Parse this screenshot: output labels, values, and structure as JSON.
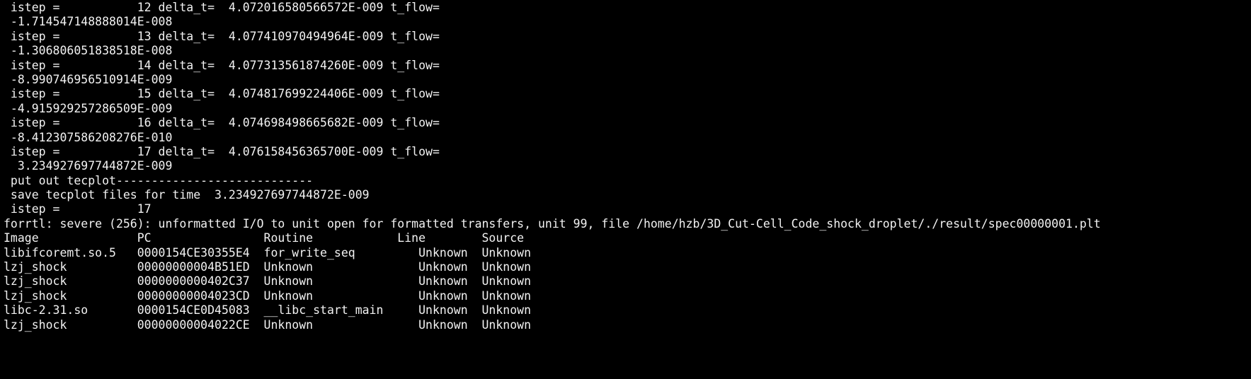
{
  "terminal": {
    "lines": [
      " istep =           12 delta_t=  4.072016580566572E-009 t_flow=",
      " -1.714547148888014E-008",
      " istep =           13 delta_t=  4.077410970494964E-009 t_flow=",
      " -1.306806051838518E-008",
      " istep =           14 delta_t=  4.077313561874260E-009 t_flow=",
      " -8.990746956510914E-009",
      " istep =           15 delta_t=  4.074817699224406E-009 t_flow=",
      " -4.915929257286509E-009",
      " istep =           16 delta_t=  4.074698498665682E-009 t_flow=",
      " -8.412307586208276E-010",
      " istep =           17 delta_t=  4.076158456365700E-009 t_flow=",
      "  3.234927697744872E-009",
      " put out tecplot----------------------------",
      " save tecplot files for time  3.234927697744872E-009",
      " istep =           17",
      "forrtl: severe (256): unformatted I/O to unit open for formatted transfers, unit 99, file /home/hzb/3D_Cut-Cell_Code_shock_droplet/./result/spec00000001.plt",
      "Image              PC                Routine            Line        Source",
      "libifcoremt.so.5   0000154CE30355E4  for_write_seq         Unknown  Unknown",
      "lzj_shock          00000000004B51ED  Unknown               Unknown  Unknown",
      "lzj_shock          0000000000402C37  Unknown               Unknown  Unknown",
      "lzj_shock          00000000004023CD  Unknown               Unknown  Unknown",
      "libc-2.31.so       0000154CE0D45083  __libc_start_main     Unknown  Unknown",
      "lzj_shock          00000000004022CE  Unknown               Unknown  Unknown"
    ]
  },
  "colors": {
    "background": "#000000",
    "text": "#f2f2f2"
  }
}
